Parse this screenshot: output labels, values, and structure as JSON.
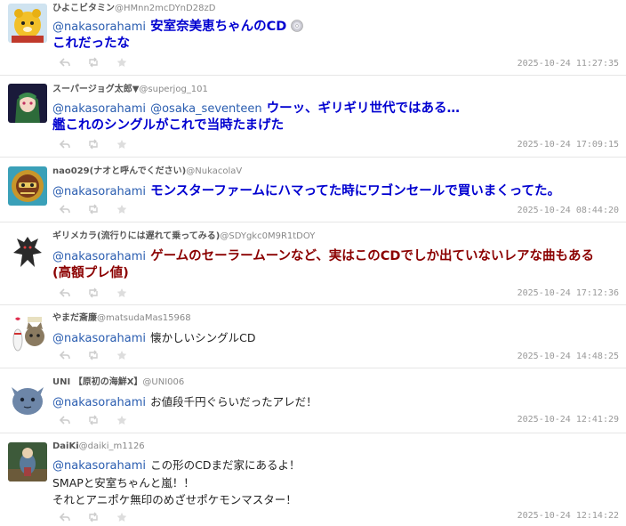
{
  "replies": [
    {
      "display_name": "ひよこビタミン",
      "handle": "@HMnn2mcDYnD28zD",
      "mention": "@nakasorahami",
      "text": "安室奈美恵ちゃんのCD",
      "text_line2": "これだったな",
      "timestamp": "2025-10-24 11:27:35",
      "avatar": "yellow-animal-plush-avatar"
    },
    {
      "display_name": "スーパージョグ太郎▼",
      "handle": "@superjog_101",
      "mention": "@nakasorahami",
      "mention2": "@osaka_seventeen",
      "text": "ウーッ、ギリギリ世代ではある…",
      "text_line2": "艦これのシングルがこれで当時たまげた",
      "timestamp": "2025-10-24 17:09:15",
      "avatar": "anime-character-avatar"
    },
    {
      "display_name": "nao029(ナオと呼んでください)",
      "handle": "@NukacolaV",
      "mention": "@nakasorahami",
      "text": "モンスターファームにハマってた時にワゴンセールで買いまくってた。",
      "timestamp": "2025-10-24 08:44:20",
      "avatar": "helmet-robot-avatar"
    },
    {
      "display_name": "ギリメカラ(流行りには遅れて乗ってみる)",
      "handle": "@SDYgkc0M9R1tDOY",
      "mention": "@nakasorahami",
      "text": "ゲームのセーラームーンなど、実はこのCDでしか出ていないレアな曲もある",
      "text_line2": "(高額プレ値)",
      "timestamp": "2025-10-24 17:12:36",
      "avatar": "dark-demon-avatar"
    },
    {
      "display_name": "やまだ斎廉",
      "handle": "@matsudaMas15968",
      "mention": "@nakasorahami",
      "text": "懐かしいシングルCD",
      "timestamp": "2025-10-24 14:48:25",
      "avatar": "bowling-cat-avatar"
    },
    {
      "display_name": "UNI 【原初の海鮮X】",
      "handle": "@UNI006",
      "mention": "@nakasorahami",
      "text": "お値段千円ぐらいだったアレだ！",
      "timestamp": "2025-10-24 12:41:29",
      "avatar": "blue-blob-avatar"
    },
    {
      "display_name": "DaiKi",
      "handle": "@daiki_m1126",
      "mention": "@nakasorahami",
      "text": "この形のCDまだ家にあるよ！",
      "text_line2": "SMAPと安室ちゃんと嵐！！",
      "text_line3": "それとアニポケ無印のめざせポケモンマスター！",
      "timestamp": "2025-10-24 12:14:22",
      "avatar": "figure-photo-avatar"
    }
  ],
  "actions": [
    "reply-icon",
    "retweet-icon",
    "like-icon"
  ],
  "colors": {
    "mention": "#2a5db0",
    "emphasis_blue": "#0000d0",
    "emphasis_red": "#8b0000"
  }
}
